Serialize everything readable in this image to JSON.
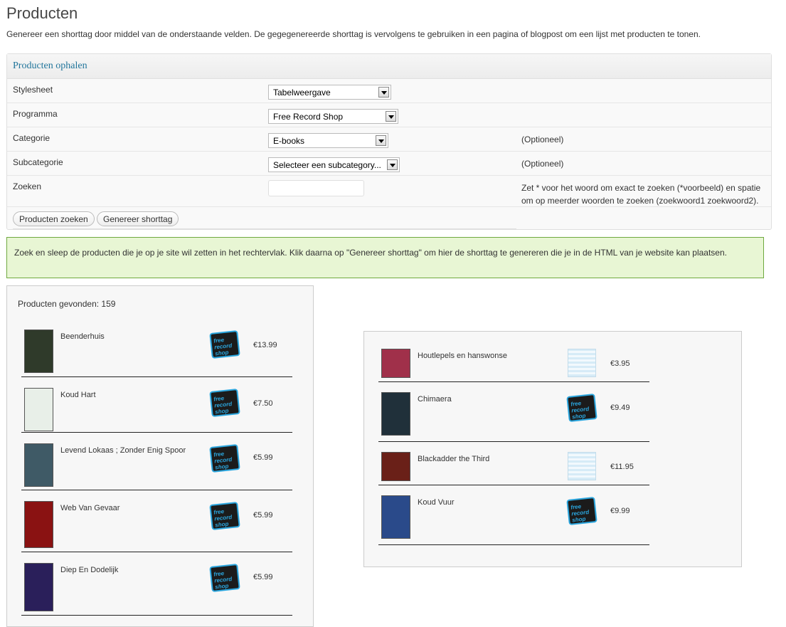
{
  "page": {
    "title": "Producten",
    "intro": "Genereer een shorttag door middel van de onderstaande velden. De gegegenereerde shorttag is vervolgens te gebruiken in een pagina of blogpost om een lijst met producten te tonen."
  },
  "form": {
    "heading": "Producten ophalen",
    "stylesheet": {
      "label": "Stylesheet",
      "value": "Tabelweergave"
    },
    "programma": {
      "label": "Programma",
      "value": "Free Record Shop"
    },
    "categorie": {
      "label": "Categorie",
      "value": "E-books",
      "note": "(Optioneel)"
    },
    "subcategorie": {
      "label": "Subcategorie",
      "value": "Selecteer een subcategory...",
      "note": "(Optioneel)"
    },
    "zoeken": {
      "label": "Zoeken",
      "value": "",
      "note": "Zet * voor het woord om exact te zoeken (*voorbeeld) en spatie om op meerder woorden te zoeken (zoekwoord1 zoekwoord2)."
    },
    "buttons": {
      "search": "Producten zoeken",
      "generate": "Genereer shorttag"
    }
  },
  "message": "Zoek en sleep de producten die je op je site wil zetten in het rechtervlak. Klik daarna op \"Genereer shorttag\" om hier de shorttag te genereren die je in de HTML van je website kan plaatsen.",
  "found": {
    "label": "Producten gevonden: 159",
    "products": [
      {
        "name": "Beenderhuis",
        "price": "€13.99",
        "shop_logo": "free-record-shop-logo",
        "cover_color": "#2f3a2a"
      },
      {
        "name": "Koud Hart",
        "price": "€7.50",
        "shop_logo": "free-record-shop-logo",
        "cover_color": "#e8efe8"
      },
      {
        "name": "Levend Lokaas ; Zonder Enig Spoor",
        "price": "€5.99",
        "shop_logo": "free-record-shop-logo",
        "cover_color": "#3f5a66"
      },
      {
        "name": "Web Van Gevaar",
        "price": "€5.99",
        "shop_logo": "free-record-shop-logo",
        "cover_color": "#8a1212"
      },
      {
        "name": "Diep En Dodelijk",
        "price": "€5.99",
        "shop_logo": "free-record-shop-logo",
        "cover_color": "#2a1f5a"
      }
    ]
  },
  "selected": {
    "products": [
      {
        "name": "Houtlepels en hanswonse",
        "price": "€3.95",
        "shop_logo": "light-blue-shop-logo",
        "cover_color": "#a0304a"
      },
      {
        "name": "Chimaera",
        "price": "€9.49",
        "shop_logo": "free-record-shop-logo",
        "cover_color": "#20303a"
      },
      {
        "name": "Blackadder the Third",
        "price": "€11.95",
        "shop_logo": "light-blue-shop-logo",
        "cover_color": "#6a2018"
      },
      {
        "name": "Koud Vuur",
        "price": "€9.99",
        "shop_logo": "free-record-shop-logo",
        "cover_color": "#2a4a8a"
      }
    ]
  }
}
